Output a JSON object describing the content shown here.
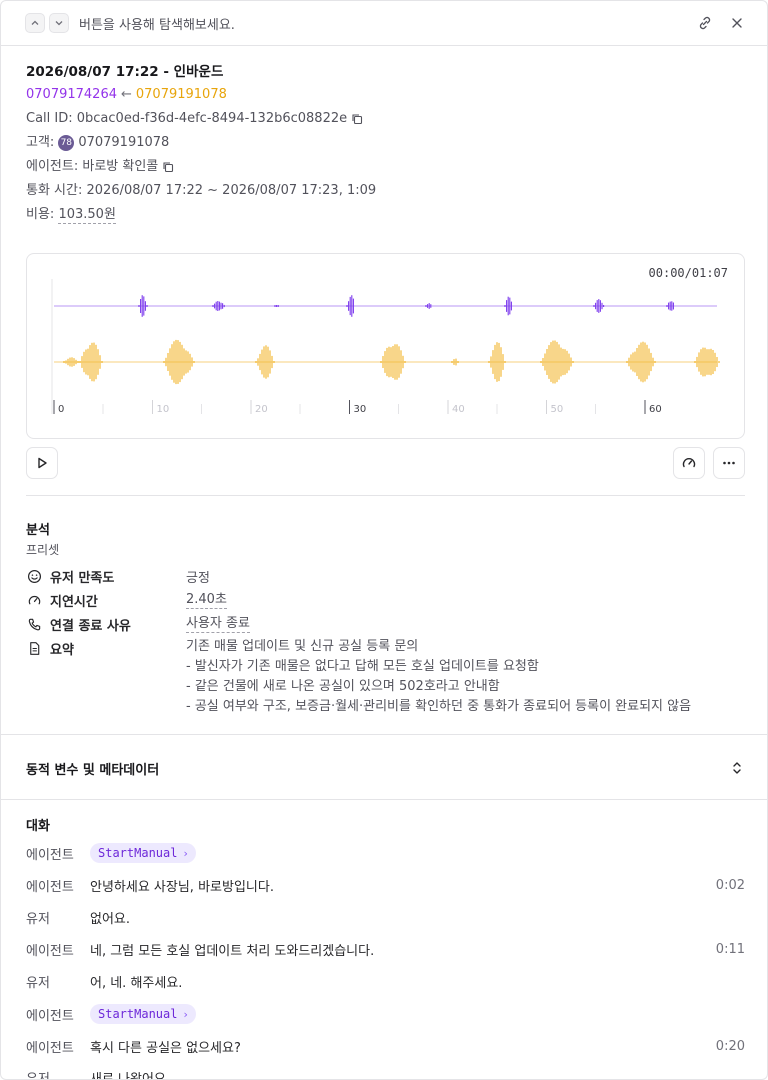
{
  "topbar": {
    "hint": "버튼을 사용해 탐색해보세요."
  },
  "call": {
    "title": "2026/08/07 17:22 - 인바운드",
    "to_number": "07079174264",
    "arrow": "←",
    "from_number": "07079191078",
    "call_id_label": "Call ID:",
    "call_id": "0bcac0ed-f36d-4efc-8494-132b6c08822e",
    "customer_label": "고객:",
    "customer_badge": "78",
    "customer_number": "07079191078",
    "agent_label": "에이전트:",
    "agent_name": "바로방 확인콜",
    "duration_label": "통화 시간:",
    "duration": "2026/08/07 17:22 ~ 2026/08/07 17:23, 1:09",
    "cost_label": "비용:",
    "cost": "103.50원"
  },
  "player": {
    "timecode": "00:00/01:07",
    "ticks": [
      "0",
      "10",
      "20",
      "30",
      "40",
      "50",
      "60"
    ],
    "agent_color": "#7c3aed",
    "user_color": "#f2b52a"
  },
  "analysis": {
    "title": "분석",
    "preset": "프리셋",
    "rows": [
      {
        "icon": "smile-icon",
        "label": "유저 만족도",
        "value": "긍정"
      },
      {
        "icon": "gauge-icon",
        "label": "지연시간",
        "value": "2.40초"
      },
      {
        "icon": "phone-icon",
        "label": "연결 종료 사유",
        "value": "사용자 종료"
      },
      {
        "icon": "document-icon",
        "label": "요약",
        "value": "기존 매물 업데이트 및 신규 공실 등록 문의"
      }
    ],
    "summary_lines": [
      "- 발신자가 기존 매물은 없다고 답해 모든 호실 업데이트를 요청함",
      "- 같은 건물에 새로 나온 공실이 있으며 502호라고 안내함",
      "- 공실 여부와 구조, 보증금·월세·관리비를 확인하던 중 통화가 종료되어 등록이 완료되지 않음"
    ]
  },
  "metadata": {
    "title": "동적 변수 및 메타데이터"
  },
  "conversation": {
    "title": "대화",
    "messages": [
      {
        "role": "에이전트",
        "chip": "StartManual",
        "text": "",
        "time": ""
      },
      {
        "role": "에이전트",
        "chip": "",
        "text": "안녕하세요 사장님, 바로방입니다.",
        "time": "0:02"
      },
      {
        "role": "유저",
        "chip": "",
        "text": "없어요.",
        "time": ""
      },
      {
        "role": "에이전트",
        "chip": "",
        "text": "네, 그럼 모든 호실 업데이트 처리 도와드리겠습니다.",
        "time": "0:11"
      },
      {
        "role": "유저",
        "chip": "",
        "text": "어, 네. 해주세요.",
        "time": ""
      },
      {
        "role": "에이전트",
        "chip": "StartManual",
        "text": "",
        "time": ""
      },
      {
        "role": "에이전트",
        "chip": "",
        "text": "혹시 다른 공실은 없으세요?",
        "time": "0:20"
      },
      {
        "role": "유저",
        "chip": "",
        "text": "새로 나왔어요.",
        "time": ""
      }
    ]
  }
}
